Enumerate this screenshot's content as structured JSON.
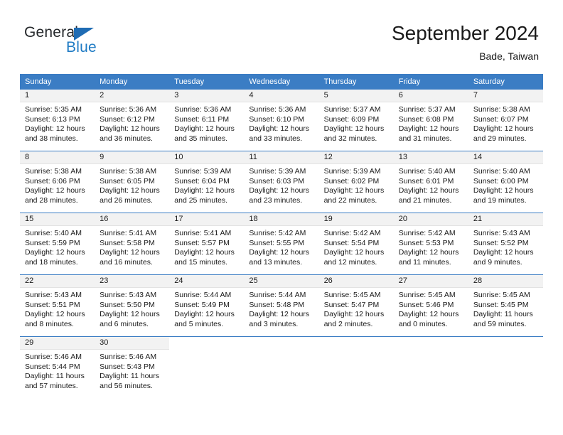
{
  "brand": {
    "name_part1": "General",
    "name_part2": "Blue",
    "flag_icon": "triangle-flag-icon"
  },
  "header": {
    "month_title": "September 2024",
    "location": "Bade, Taiwan"
  },
  "theme": {
    "header_blue": "#3b7dc4",
    "brand_blue": "#1f7bc4",
    "daynum_band": "#f2f2f2",
    "text": "#1a1a1a"
  },
  "weekdays": [
    "Sunday",
    "Monday",
    "Tuesday",
    "Wednesday",
    "Thursday",
    "Friday",
    "Saturday"
  ],
  "weeks": [
    [
      {
        "day": "1",
        "sunrise": "Sunrise: 5:35 AM",
        "sunset": "Sunset: 6:13 PM",
        "daylight_1": "Daylight: 12 hours",
        "daylight_2": "and 38 minutes."
      },
      {
        "day": "2",
        "sunrise": "Sunrise: 5:36 AM",
        "sunset": "Sunset: 6:12 PM",
        "daylight_1": "Daylight: 12 hours",
        "daylight_2": "and 36 minutes."
      },
      {
        "day": "3",
        "sunrise": "Sunrise: 5:36 AM",
        "sunset": "Sunset: 6:11 PM",
        "daylight_1": "Daylight: 12 hours",
        "daylight_2": "and 35 minutes."
      },
      {
        "day": "4",
        "sunrise": "Sunrise: 5:36 AM",
        "sunset": "Sunset: 6:10 PM",
        "daylight_1": "Daylight: 12 hours",
        "daylight_2": "and 33 minutes."
      },
      {
        "day": "5",
        "sunrise": "Sunrise: 5:37 AM",
        "sunset": "Sunset: 6:09 PM",
        "daylight_1": "Daylight: 12 hours",
        "daylight_2": "and 32 minutes."
      },
      {
        "day": "6",
        "sunrise": "Sunrise: 5:37 AM",
        "sunset": "Sunset: 6:08 PM",
        "daylight_1": "Daylight: 12 hours",
        "daylight_2": "and 31 minutes."
      },
      {
        "day": "7",
        "sunrise": "Sunrise: 5:38 AM",
        "sunset": "Sunset: 6:07 PM",
        "daylight_1": "Daylight: 12 hours",
        "daylight_2": "and 29 minutes."
      }
    ],
    [
      {
        "day": "8",
        "sunrise": "Sunrise: 5:38 AM",
        "sunset": "Sunset: 6:06 PM",
        "daylight_1": "Daylight: 12 hours",
        "daylight_2": "and 28 minutes."
      },
      {
        "day": "9",
        "sunrise": "Sunrise: 5:38 AM",
        "sunset": "Sunset: 6:05 PM",
        "daylight_1": "Daylight: 12 hours",
        "daylight_2": "and 26 minutes."
      },
      {
        "day": "10",
        "sunrise": "Sunrise: 5:39 AM",
        "sunset": "Sunset: 6:04 PM",
        "daylight_1": "Daylight: 12 hours",
        "daylight_2": "and 25 minutes."
      },
      {
        "day": "11",
        "sunrise": "Sunrise: 5:39 AM",
        "sunset": "Sunset: 6:03 PM",
        "daylight_1": "Daylight: 12 hours",
        "daylight_2": "and 23 minutes."
      },
      {
        "day": "12",
        "sunrise": "Sunrise: 5:39 AM",
        "sunset": "Sunset: 6:02 PM",
        "daylight_1": "Daylight: 12 hours",
        "daylight_2": "and 22 minutes."
      },
      {
        "day": "13",
        "sunrise": "Sunrise: 5:40 AM",
        "sunset": "Sunset: 6:01 PM",
        "daylight_1": "Daylight: 12 hours",
        "daylight_2": "and 21 minutes."
      },
      {
        "day": "14",
        "sunrise": "Sunrise: 5:40 AM",
        "sunset": "Sunset: 6:00 PM",
        "daylight_1": "Daylight: 12 hours",
        "daylight_2": "and 19 minutes."
      }
    ],
    [
      {
        "day": "15",
        "sunrise": "Sunrise: 5:40 AM",
        "sunset": "Sunset: 5:59 PM",
        "daylight_1": "Daylight: 12 hours",
        "daylight_2": "and 18 minutes."
      },
      {
        "day": "16",
        "sunrise": "Sunrise: 5:41 AM",
        "sunset": "Sunset: 5:58 PM",
        "daylight_1": "Daylight: 12 hours",
        "daylight_2": "and 16 minutes."
      },
      {
        "day": "17",
        "sunrise": "Sunrise: 5:41 AM",
        "sunset": "Sunset: 5:57 PM",
        "daylight_1": "Daylight: 12 hours",
        "daylight_2": "and 15 minutes."
      },
      {
        "day": "18",
        "sunrise": "Sunrise: 5:42 AM",
        "sunset": "Sunset: 5:55 PM",
        "daylight_1": "Daylight: 12 hours",
        "daylight_2": "and 13 minutes."
      },
      {
        "day": "19",
        "sunrise": "Sunrise: 5:42 AM",
        "sunset": "Sunset: 5:54 PM",
        "daylight_1": "Daylight: 12 hours",
        "daylight_2": "and 12 minutes."
      },
      {
        "day": "20",
        "sunrise": "Sunrise: 5:42 AM",
        "sunset": "Sunset: 5:53 PM",
        "daylight_1": "Daylight: 12 hours",
        "daylight_2": "and 11 minutes."
      },
      {
        "day": "21",
        "sunrise": "Sunrise: 5:43 AM",
        "sunset": "Sunset: 5:52 PM",
        "daylight_1": "Daylight: 12 hours",
        "daylight_2": "and 9 minutes."
      }
    ],
    [
      {
        "day": "22",
        "sunrise": "Sunrise: 5:43 AM",
        "sunset": "Sunset: 5:51 PM",
        "daylight_1": "Daylight: 12 hours",
        "daylight_2": "and 8 minutes."
      },
      {
        "day": "23",
        "sunrise": "Sunrise: 5:43 AM",
        "sunset": "Sunset: 5:50 PM",
        "daylight_1": "Daylight: 12 hours",
        "daylight_2": "and 6 minutes."
      },
      {
        "day": "24",
        "sunrise": "Sunrise: 5:44 AM",
        "sunset": "Sunset: 5:49 PM",
        "daylight_1": "Daylight: 12 hours",
        "daylight_2": "and 5 minutes."
      },
      {
        "day": "25",
        "sunrise": "Sunrise: 5:44 AM",
        "sunset": "Sunset: 5:48 PM",
        "daylight_1": "Daylight: 12 hours",
        "daylight_2": "and 3 minutes."
      },
      {
        "day": "26",
        "sunrise": "Sunrise: 5:45 AM",
        "sunset": "Sunset: 5:47 PM",
        "daylight_1": "Daylight: 12 hours",
        "daylight_2": "and 2 minutes."
      },
      {
        "day": "27",
        "sunrise": "Sunrise: 5:45 AM",
        "sunset": "Sunset: 5:46 PM",
        "daylight_1": "Daylight: 12 hours",
        "daylight_2": "and 0 minutes."
      },
      {
        "day": "28",
        "sunrise": "Sunrise: 5:45 AM",
        "sunset": "Sunset: 5:45 PM",
        "daylight_1": "Daylight: 11 hours",
        "daylight_2": "and 59 minutes."
      }
    ],
    [
      {
        "day": "29",
        "sunrise": "Sunrise: 5:46 AM",
        "sunset": "Sunset: 5:44 PM",
        "daylight_1": "Daylight: 11 hours",
        "daylight_2": "and 57 minutes."
      },
      {
        "day": "30",
        "sunrise": "Sunrise: 5:46 AM",
        "sunset": "Sunset: 5:43 PM",
        "daylight_1": "Daylight: 11 hours",
        "daylight_2": "and 56 minutes."
      },
      {
        "day": "",
        "sunrise": "",
        "sunset": "",
        "daylight_1": "",
        "daylight_2": ""
      },
      {
        "day": "",
        "sunrise": "",
        "sunset": "",
        "daylight_1": "",
        "daylight_2": ""
      },
      {
        "day": "",
        "sunrise": "",
        "sunset": "",
        "daylight_1": "",
        "daylight_2": ""
      },
      {
        "day": "",
        "sunrise": "",
        "sunset": "",
        "daylight_1": "",
        "daylight_2": ""
      },
      {
        "day": "",
        "sunrise": "",
        "sunset": "",
        "daylight_1": "",
        "daylight_2": ""
      }
    ]
  ]
}
